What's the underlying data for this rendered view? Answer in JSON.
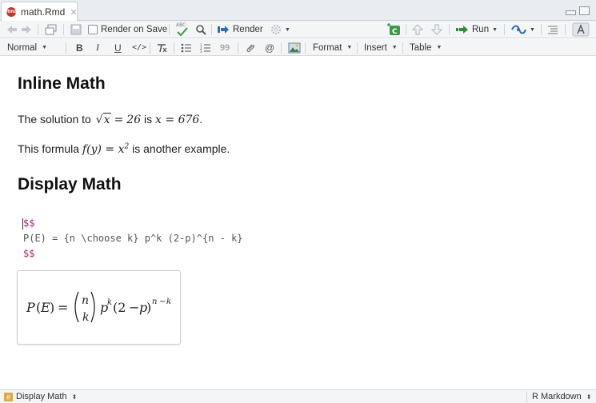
{
  "tab": {
    "title": "math.Rmd",
    "close": "✕"
  },
  "toolbar": {
    "render_on_save": "Render on Save",
    "spell_text": "ABC",
    "render": "Render",
    "run": "Run"
  },
  "formatbar": {
    "style": "Normal",
    "bold": "B",
    "italic": "I",
    "underline": "U",
    "code": "</>",
    "quote": "99",
    "at": "@",
    "format": "Format",
    "insert": "Insert",
    "table": "Table"
  },
  "doc": {
    "heading_inline": "Inline Math",
    "p1_prefix": "The solution to",
    "p1_mid": "is",
    "p1_eq1": "√x = 26",
    "p1_eq2": "x = 676",
    "p1_end": ".",
    "p2_prefix": "This formula",
    "p2_eq": "f(y) = x²",
    "p2_suffix": "is another example.",
    "heading_display": "Display Math",
    "code_open": "$$",
    "code_body": "P(E) = {n \\choose k} p^k (2-p)^{n - k}",
    "code_close": "$$",
    "rendered_eq": "P(E) = (n choose k) p^k (2 − p)^(n−k)"
  },
  "status": {
    "section": "Display Math",
    "mode": "R Markdown"
  },
  "colors": {
    "toolbar_bg": "#f3f5f7",
    "delimiter": "#b0206e",
    "rmd_icon": "#c0392b",
    "run_green": "#2e8b3a",
    "render_blue": "#2f6db5"
  }
}
